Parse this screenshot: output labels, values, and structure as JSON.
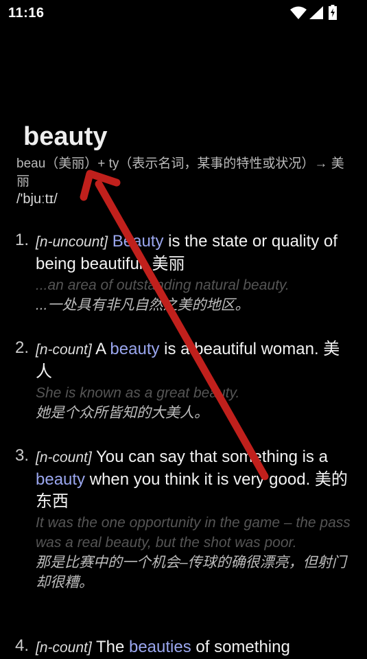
{
  "status": {
    "time": "11:16"
  },
  "entry": {
    "headword": "beauty",
    "etymology": "beau（美丽）+ ty（表示名词，某事的特性或状况）→ 美丽",
    "phonetic": "/'bjuːtɪ/",
    "senses": [
      {
        "num": "1.",
        "grammar": "[n-uncount]",
        "kw": "Beauty",
        "def_post": " is the state or quality of being beautiful. 美丽",
        "ex_en": "...an area of outstanding natural beauty.",
        "ex_zh": "...一处具有非凡自然之美的地区。"
      },
      {
        "num": "2.",
        "grammar": "[n-count]",
        "def_pre": " A ",
        "kw": "beauty",
        "def_post": " is a beautiful woman. 美人",
        "ex_en": "She is known as a great beauty.",
        "ex_zh": "她是个众所皆知的大美人。"
      },
      {
        "num": "3.",
        "grammar": "[n-count]",
        "def_pre": " You can say that something is a ",
        "kw": "beauty",
        "def_post": " when you think it is very good. 美的东西",
        "ex_en": "It was the one opportunity in the game – the pass was a real beauty, but the shot was poor.",
        "ex_zh": "那是比赛中的一个机会–传球的确很漂亮，但射门却很糟。"
      },
      {
        "num": "4.",
        "grammar": "[n-count]",
        "def_pre": " The ",
        "kw": "beauties",
        "def_post": " of something"
      }
    ]
  },
  "colors": {
    "background": "#000000",
    "keyword": "#9aa6ee",
    "arrow": "#c0201c"
  }
}
